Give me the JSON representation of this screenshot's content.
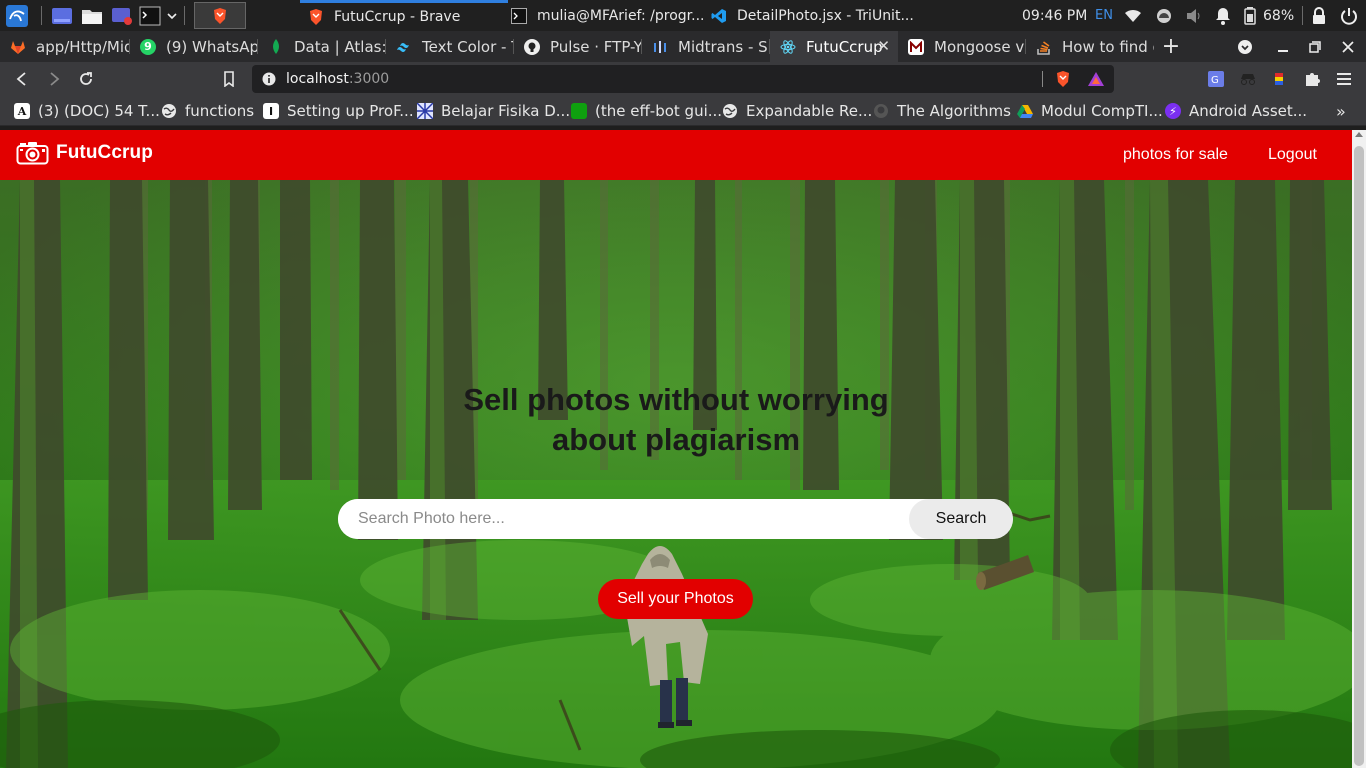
{
  "taskbar": {
    "tasks": [
      {
        "title": "FutuCcrup - Brave",
        "active": true
      },
      {
        "title": "mulia@MFArief: /progr...",
        "active": false
      },
      {
        "title": "DetailPhoto.jsx - TriUnit...",
        "active": false
      }
    ],
    "clock": "09:46 PM",
    "keyboard_layout": "EN",
    "battery": "68%"
  },
  "browser": {
    "tabs": [
      {
        "title": "app/Http/Mid",
        "favicon": "gitlab-icon",
        "active": false
      },
      {
        "title": "(9) WhatsApp",
        "favicon": "whatsapp-icon",
        "active": false
      },
      {
        "title": "Data | Atlas: M",
        "favicon": "mongodb-icon",
        "active": false
      },
      {
        "title": "Text Color - T",
        "favicon": "tailwind-icon",
        "active": false
      },
      {
        "title": "Pulse · FTP-Y",
        "favicon": "github-icon",
        "active": false
      },
      {
        "title": "Midtrans - Sn",
        "favicon": "midtrans-icon",
        "active": false
      },
      {
        "title": "FutuCcrup",
        "favicon": "react-icon",
        "active": true
      },
      {
        "title": "Mongoose v6",
        "favicon": "mongoose-icon",
        "active": false
      },
      {
        "title": "How to find d",
        "favicon": "stackoverflow-icon",
        "active": false
      }
    ],
    "url": {
      "host": "localhost",
      "port": ":3000"
    },
    "bookmarks": [
      {
        "label": "(3) (DOC) 54 T...",
        "icon": "academia-icon"
      },
      {
        "label": "functions",
        "icon": "globe-icon"
      },
      {
        "label": "Setting up ProF...",
        "icon": "dev-icon"
      },
      {
        "label": "Belajar Fisika D...",
        "icon": "pattern-icon"
      },
      {
        "label": "(the eff-bot gui...",
        "icon": "green-square-icon"
      },
      {
        "label": "Expandable Re...",
        "icon": "globe-icon"
      },
      {
        "label": "The Algorithms",
        "icon": "github-icon"
      },
      {
        "label": "Modul CompTI...",
        "icon": "drive-icon"
      },
      {
        "label": "Android Asset...",
        "icon": "android-asset-icon"
      }
    ]
  },
  "app": {
    "brand": "FutuCcrup",
    "nav_links": [
      "photos for sale",
      "Logout"
    ],
    "hero": {
      "title_line1": "Sell photos without worrying",
      "title_line2": "about plagiarism",
      "search_placeholder": "Search Photo here...",
      "search_button": "Search",
      "cta_button": "Sell your Photos"
    }
  },
  "colors": {
    "brand_red": "#e20000",
    "forest_green": "#2f7a1e",
    "browser_toolbar": "#3a3a3d",
    "taskbar": "#202020"
  }
}
